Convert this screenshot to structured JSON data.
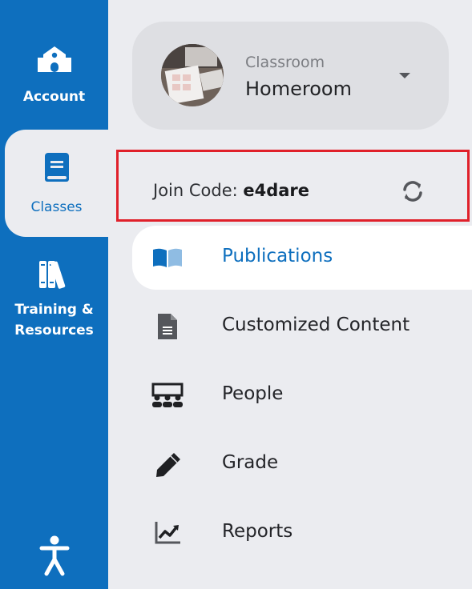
{
  "rail": {
    "account_label": "Account",
    "classes_label": "Classes",
    "training_label_line1": "Training &",
    "training_label_line2": "Resources",
    "icons": [
      "school-icon",
      "book-icon",
      "library-icon",
      "accessibility-icon"
    ]
  },
  "classroom": {
    "eyebrow": "Classroom",
    "name": "Homeroom"
  },
  "join": {
    "label": "Join Code: ",
    "code": "e4dare"
  },
  "nav": {
    "items": [
      {
        "label": "Publications",
        "icon": "open-book-icon",
        "active": true
      },
      {
        "label": "Customized Content",
        "icon": "document-icon",
        "active": false
      },
      {
        "label": "People",
        "icon": "people-icon",
        "active": false
      },
      {
        "label": "Grade",
        "icon": "pen-icon",
        "active": false
      },
      {
        "label": "Reports",
        "icon": "chart-icon",
        "active": false
      }
    ]
  },
  "colors": {
    "brand_blue": "#0e6fbe",
    "background": "#ebecf0",
    "highlight_border": "#e0202a"
  }
}
